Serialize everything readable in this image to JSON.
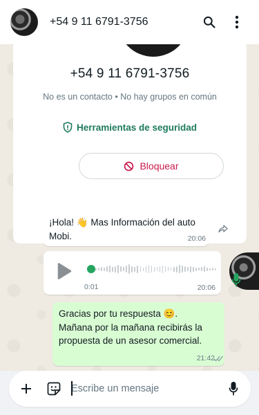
{
  "header": {
    "title": "+54 9 11 6791-3756",
    "search_icon": "search-icon",
    "menu_icon": "more-vertical-icon"
  },
  "profile": {
    "phone": "+54 9 11 6791-3756",
    "subtitle": "No es un contacto • No hay grupos en común",
    "security_label": "Herramientas de seguridad",
    "block_label": "Bloquear"
  },
  "messages": [
    {
      "direction": "in",
      "text": "¡Hola! 👋 Mas Información del auto Mobi.",
      "time": "20:06"
    },
    {
      "direction": "in",
      "type": "voice",
      "position": "0:01",
      "time": "20:06"
    },
    {
      "direction": "out",
      "text": "Gracias por tu respuesta 😊.\nMañana por la mañana recibirás la propuesta de un asesor comercial.",
      "time": "21:42",
      "status": "read"
    }
  ],
  "composer": {
    "placeholder": "Escribe un mensaje"
  },
  "colors": {
    "accent": "#25a55f",
    "security": "#1e7a5f",
    "danger": "#c9194c",
    "outgoing_bubble": "#d9fdd3",
    "background": "#efeae2"
  }
}
